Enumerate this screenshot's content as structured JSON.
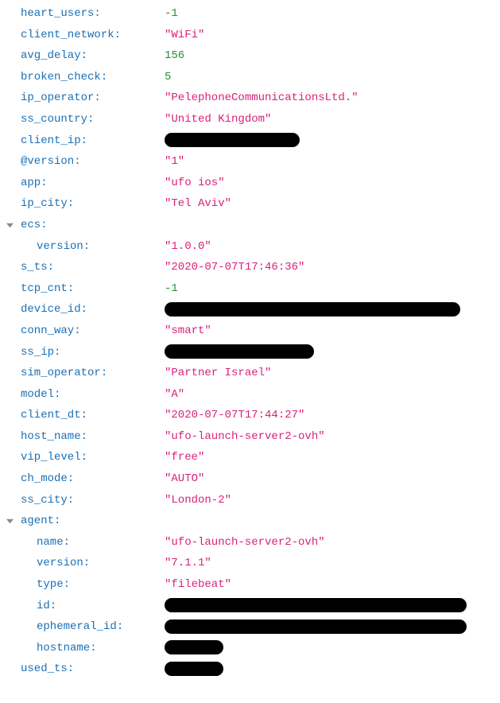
{
  "colors": {
    "key": "#1a6fb5",
    "string": "#d9217c",
    "number": "#1f8f3a",
    "redact": "#000000"
  },
  "rows": [
    {
      "key": "heart_users:",
      "value": "-1",
      "type": "num",
      "indent": 0
    },
    {
      "key": "client_network:",
      "value": "\"WiFi\"",
      "type": "str",
      "indent": 0
    },
    {
      "key": "avg_delay:",
      "value": "156",
      "type": "num",
      "indent": 0
    },
    {
      "key": "broken_check:",
      "value": "5",
      "type": "num",
      "indent": 0
    },
    {
      "key": "ip_operator:",
      "value": "\"PelephoneCommunicationsLtd.\"",
      "type": "str",
      "indent": 0
    },
    {
      "key": "ss_country:",
      "value": "\"United Kingdom\"",
      "type": "str",
      "indent": 0
    },
    {
      "key": "client_ip:",
      "value": "",
      "type": "red",
      "indent": 0,
      "rw": "w170"
    },
    {
      "key": "@version:",
      "value": "\"1\"",
      "type": "str",
      "indent": 0
    },
    {
      "key": "app:",
      "value": "\"ufo ios\"",
      "type": "str",
      "indent": 0
    },
    {
      "key": "ip_city:",
      "value": "\"Tel Aviv\"",
      "type": "str",
      "indent": 0
    },
    {
      "key": "ecs:",
      "value": "",
      "type": "none",
      "indent": 0,
      "expander": true
    },
    {
      "key": "version:",
      "value": "\"1.0.0\"",
      "type": "str",
      "indent": 1
    },
    {
      "key": "s_ts:",
      "value": "\"2020-07-07T17:46:36\"",
      "type": "str",
      "indent": 0
    },
    {
      "key": "tcp_cnt:",
      "value": "-1",
      "type": "num",
      "indent": 0
    },
    {
      "key": "device_id:",
      "value": "",
      "type": "red",
      "indent": 0,
      "rw": "w372"
    },
    {
      "key": "conn_way:",
      "value": "\"smart\"",
      "type": "str",
      "indent": 0
    },
    {
      "key": "ss_ip:",
      "value": "",
      "type": "red",
      "indent": 0,
      "rw": "w188"
    },
    {
      "key": "sim_operator:",
      "value": "\"Partner Israel\"",
      "type": "str",
      "indent": 0
    },
    {
      "key": "model:",
      "value": "\"A\"",
      "type": "str",
      "indent": 0
    },
    {
      "key": "client_dt:",
      "value": "\"2020-07-07T17:44:27\"",
      "type": "str",
      "indent": 0
    },
    {
      "key": "host_name:",
      "value": "\"ufo-launch-server2-ovh\"",
      "type": "str",
      "indent": 0
    },
    {
      "key": "vip_level:",
      "value": "\"free\"",
      "type": "str",
      "indent": 0
    },
    {
      "key": "ch_mode:",
      "value": "\"AUTO\"",
      "type": "str",
      "indent": 0
    },
    {
      "key": "ss_city:",
      "value": "\"London-2\"",
      "type": "str",
      "indent": 0
    },
    {
      "key": "agent:",
      "value": "",
      "type": "none",
      "indent": 0,
      "expander": true
    },
    {
      "key": "name:",
      "value": "\"ufo-launch-server2-ovh\"",
      "type": "str",
      "indent": 1
    },
    {
      "key": "version:",
      "value": "\"7.1.1\"",
      "type": "str",
      "indent": 1
    },
    {
      "key": "type:",
      "value": "\"filebeat\"",
      "type": "str",
      "indent": 1
    },
    {
      "key": "id:",
      "value": "",
      "type": "red",
      "indent": 1,
      "rw": "w380"
    },
    {
      "key": "ephemeral_id:",
      "value": "",
      "type": "red",
      "indent": 1,
      "rw": "w380"
    },
    {
      "key": "hostname:",
      "value": "",
      "type": "red",
      "indent": 1,
      "rw": "w74"
    },
    {
      "key": "used_ts:",
      "value": "",
      "type": "red",
      "indent": 0,
      "rw": "w74"
    }
  ]
}
